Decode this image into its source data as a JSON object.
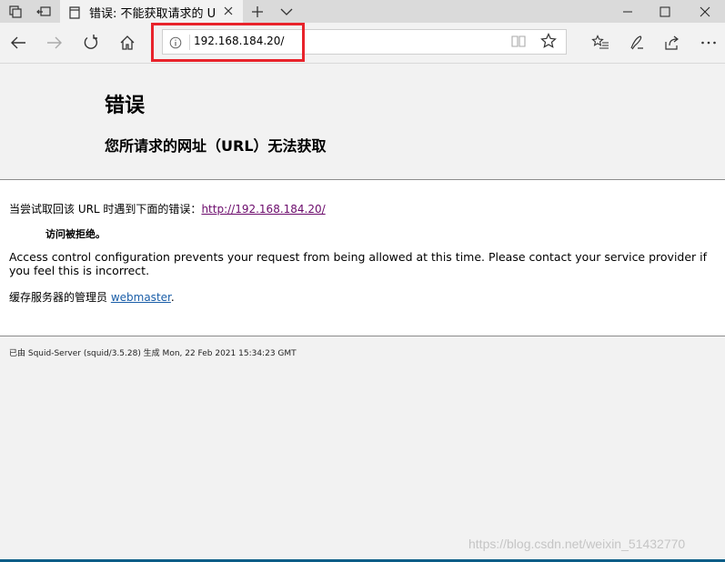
{
  "tab": {
    "title": "错误: 不能获取请求的 U"
  },
  "toolbar": {
    "url": "192.168.184.20/"
  },
  "page": {
    "heading": "错误",
    "subheading": "您所请求的网址（URL）无法获取",
    "try_text": "当尝试取回该 URL 时遇到下面的错误：",
    "try_link": "http://192.168.184.20/",
    "denied": "访问被拒绝。",
    "message": "Access control configuration prevents your request from being allowed at this time. Please contact your service provider if you feel this is incorrect.",
    "admin_text": "缓存服务器的管理员 ",
    "admin_link": "webmaster",
    "admin_suffix": ".",
    "footer": "已由 Squid-Server (squid/3.5.28) 生成 Mon, 22 Feb 2021 15:34:23 GMT"
  },
  "watermark": "https://blog.csdn.net/weixin_51432770",
  "colors": {
    "highlight": "#e8232b",
    "visited_link": "#6b0a6b",
    "link": "#1a5ea8"
  },
  "icons": [
    "tab-manager-icon",
    "set-aside-tabs-icon",
    "page-icon",
    "close-icon",
    "new-tab-icon",
    "tab-list-chevron-icon",
    "minimize-icon",
    "maximize-icon",
    "close-window-icon",
    "back-icon",
    "forward-icon",
    "refresh-icon",
    "home-icon",
    "info-icon",
    "reading-view-icon",
    "favorite-star-icon",
    "favorites-hub-icon",
    "web-note-icon",
    "share-icon",
    "more-icon"
  ]
}
